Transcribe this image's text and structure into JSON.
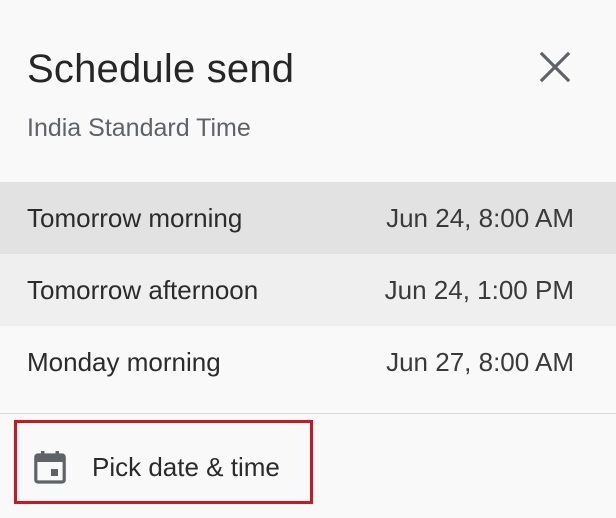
{
  "dialog": {
    "title": "Schedule send",
    "subtitle": "India Standard Time",
    "close_icon": "close-icon",
    "options": [
      {
        "label": "Tomorrow morning",
        "time": "Jun 24, 8:00 AM",
        "state": "hover"
      },
      {
        "label": "Tomorrow afternoon",
        "time": "Jun 24, 1:00 PM",
        "state": "normal"
      },
      {
        "label": "Monday morning",
        "time": "Jun 27, 8:00 AM",
        "state": "normal"
      }
    ],
    "pick": {
      "label": "Pick date & time",
      "icon": "calendar-icon",
      "highlight_color": "#d0151c"
    }
  }
}
